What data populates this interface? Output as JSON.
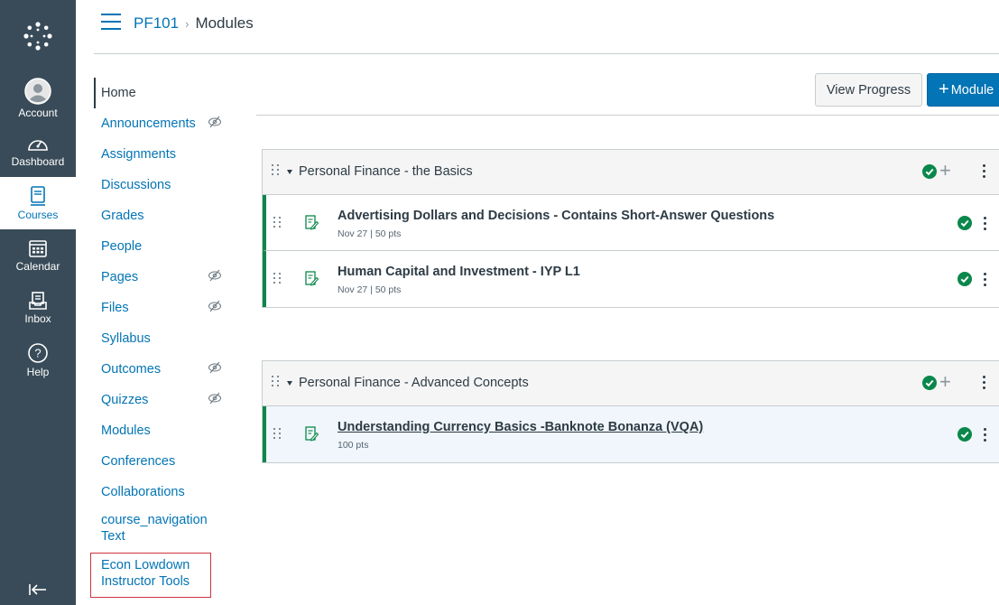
{
  "global_nav": {
    "logo_icon": "canvas-logo-icon",
    "items": [
      {
        "label": "Account",
        "icon": "account-icon"
      },
      {
        "label": "Dashboard",
        "icon": "dashboard-icon"
      },
      {
        "label": "Courses",
        "icon": "courses-icon",
        "active": true
      },
      {
        "label": "Calendar",
        "icon": "calendar-icon"
      },
      {
        "label": "Inbox",
        "icon": "inbox-icon"
      },
      {
        "label": "Help",
        "icon": "help-icon"
      }
    ],
    "collapse_icon": "collapse-nav-icon"
  },
  "breadcrumb": {
    "course": "PF101",
    "separator": "›",
    "current": "Modules"
  },
  "course_nav": {
    "items": [
      {
        "label": "Home",
        "active": true,
        "hidden": false
      },
      {
        "label": "Announcements",
        "hidden": true
      },
      {
        "label": "Assignments",
        "hidden": false
      },
      {
        "label": "Discussions",
        "hidden": false
      },
      {
        "label": "Grades",
        "hidden": false
      },
      {
        "label": "People",
        "hidden": false
      },
      {
        "label": "Pages",
        "hidden": true
      },
      {
        "label": "Files",
        "hidden": true
      },
      {
        "label": "Syllabus",
        "hidden": false
      },
      {
        "label": "Outcomes",
        "hidden": true
      },
      {
        "label": "Quizzes",
        "hidden": true
      },
      {
        "label": "Modules",
        "hidden": false
      },
      {
        "label": "Conferences",
        "hidden": false
      },
      {
        "label": "Collaborations",
        "hidden": false
      },
      {
        "label": "course_navigation Text",
        "hidden": false
      },
      {
        "label": "Econ Lowdown Instructor Tools",
        "hidden": false,
        "highlighted": true
      }
    ]
  },
  "header": {
    "view_progress_label": "View Progress",
    "add_module_plus": "+",
    "add_module_label": "Module"
  },
  "modules": [
    {
      "title": "Personal Finance - the Basics",
      "published": true,
      "items": [
        {
          "title": "Advertising Dollars and Decisions - Contains Short-Answer Questions",
          "meta": "Nov 27  |  50 pts",
          "published": true
        },
        {
          "title": "Human Capital and Investment - IYP L1",
          "meta": "Nov 27  |  50 pts",
          "published": true
        }
      ]
    },
    {
      "title": "Personal Finance - Advanced Concepts",
      "published": true,
      "items": [
        {
          "title": "Understanding Currency Basics -Banknote Bonanza (VQA)",
          "meta": "100 pts",
          "published": true,
          "hovered": true
        }
      ]
    }
  ],
  "colors": {
    "nav_bg": "#394b58",
    "link": "#0374b5",
    "success": "#0b874b",
    "highlight_box": "#d0323c"
  }
}
